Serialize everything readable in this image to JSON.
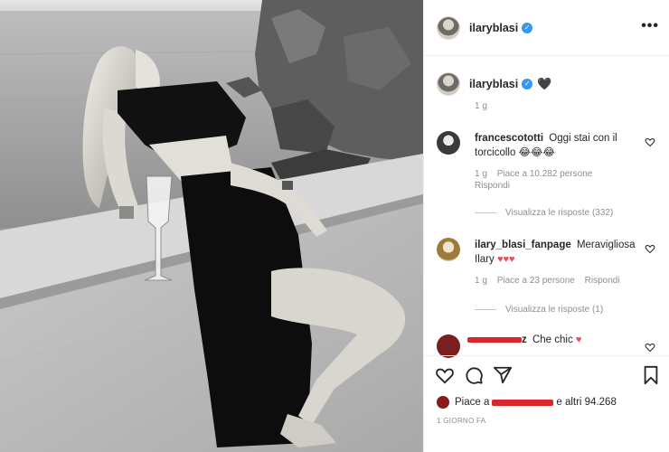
{
  "post": {
    "author": "ilaryblasi",
    "caption_emoji": "🖤",
    "caption_time": "1 g",
    "more_label": "•••"
  },
  "comments": [
    {
      "user": "francescototti",
      "text": "Oggi stai con il torcicollo",
      "emoji": "😂😂😂",
      "time": "1 g",
      "likes": "Piace a 10.282 persone",
      "reply": "Rispondi",
      "view_replies": "Visualizza le risposte (332)"
    },
    {
      "user": "ilary_blasi_fanpage",
      "text": "Meravigliosa Ilary",
      "emoji": "♥♥♥",
      "time": "1 g",
      "likes": "Piace a 23 persone",
      "reply": "Rispondi",
      "view_replies": "Visualizza le risposte (1)"
    },
    {
      "user_prefix": "z",
      "text": "Che chic",
      "emoji": "♥"
    }
  ],
  "footer": {
    "likes_prefix": "Piace a",
    "likes_suffix": "e altri 94.268",
    "time": "1 GIORNO FA"
  },
  "icons": {
    "like": "heart-outline-icon",
    "comment": "comment-bubble-icon",
    "share": "paper-plane-icon",
    "save": "bookmark-icon",
    "verified": "verified-badge-icon",
    "more": "more-dots-icon"
  },
  "colors": {
    "verified": "#3897f0",
    "like_red": "#ed4956",
    "muted": "#8e8e8e"
  }
}
